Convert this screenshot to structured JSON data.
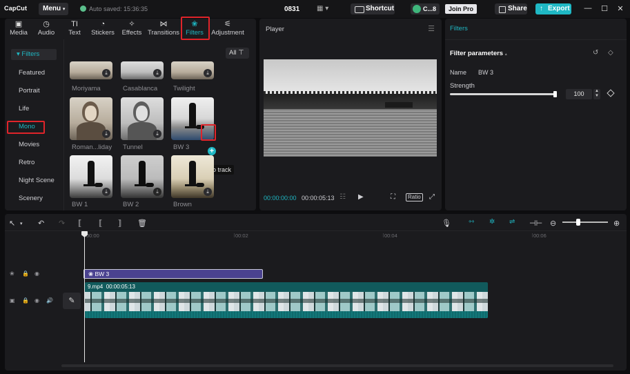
{
  "titlebar": {
    "app_name": "CapCut",
    "menu_label": "Menu",
    "autosave_text": "Auto saved: 15:36:35",
    "project_name": "0831",
    "shortcut_label": "Shortcut",
    "account_label": "C...8",
    "join_pro_label": "Join Pro",
    "share_label": "Share",
    "export_label": "Export"
  },
  "media_tabs": [
    {
      "label": "Media",
      "icon": "media-icon"
    },
    {
      "label": "Audio",
      "icon": "audio-icon"
    },
    {
      "label": "Text",
      "icon": "text-icon"
    },
    {
      "label": "Stickers",
      "icon": "stickers-icon"
    },
    {
      "label": "Effects",
      "icon": "effects-icon"
    },
    {
      "label": "Transitions",
      "icon": "transitions-icon"
    },
    {
      "label": "Filters",
      "icon": "filters-icon",
      "active": true
    },
    {
      "label": "Adjustment",
      "icon": "adjustment-icon"
    }
  ],
  "filter_sidebar": {
    "header": "Filters",
    "items": [
      "Featured",
      "Portrait",
      "Life",
      "Mono",
      "Movies",
      "Retro",
      "Night Scene",
      "Scenery"
    ],
    "active": "Mono"
  },
  "filter_grid": {
    "all_label": "All",
    "row1": [
      "Moriyama",
      "Casablanca",
      "Twilight"
    ],
    "row2": [
      "Roman...liday",
      "Tunnel",
      "BW 3"
    ],
    "row3": [
      "BW 1",
      "BW 2",
      "Brown"
    ],
    "tooltip": "Add to track"
  },
  "player": {
    "title": "Player",
    "current_time": "00:00:00:00",
    "total_time": "00:00:05:13",
    "ratio_label": "Ratio"
  },
  "filter_params": {
    "tab": "Filters",
    "title": "Filter parameters",
    "name_label": "Name",
    "name_value": "BW 3",
    "strength_label": "Strength",
    "strength_value": "100"
  },
  "timeline": {
    "ruler": [
      "00:00",
      "00:02",
      "00:04",
      "00:06"
    ],
    "filter_clip_label": "BW 3",
    "video_clip_name": "9.mp4",
    "video_clip_duration": "00:00:05:13"
  },
  "colors": {
    "accent": "#1fb8c4",
    "highlight": "#e0242a",
    "filter_clip": "#4a428f",
    "video_clip": "#115a5c"
  }
}
